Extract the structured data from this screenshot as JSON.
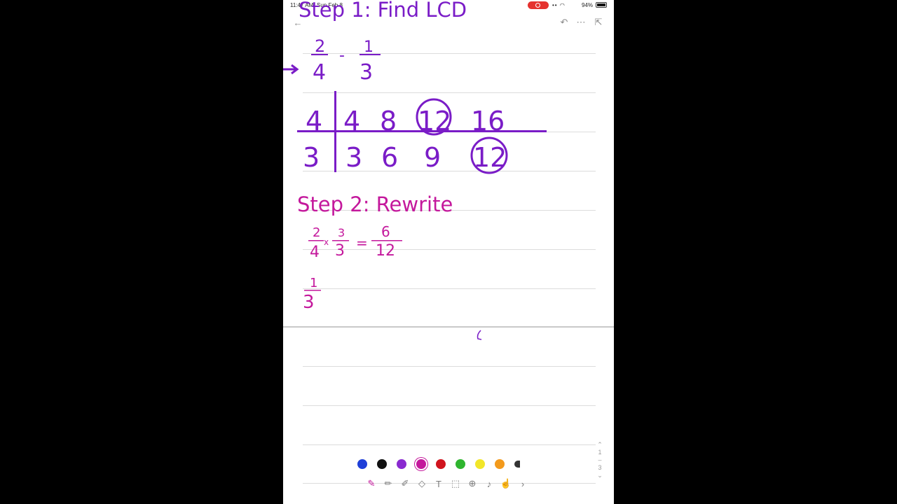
{
  "status_bar": {
    "time": "11:47 AM",
    "date": "Sun Feb 8",
    "battery": "94%"
  },
  "note": {
    "step1": {
      "heading": "Step 1: Find LCD",
      "fraction_a": {
        "numerator": "2",
        "denominator": "4"
      },
      "operator": "-",
      "fraction_b": {
        "numerator": "1",
        "denominator": "3"
      },
      "table": {
        "row_header_top": "4",
        "row_top": [
          "4",
          "8",
          "12",
          "16"
        ],
        "row_header_bottom": "3",
        "row_bottom": [
          "3",
          "6",
          "9",
          "12"
        ]
      }
    },
    "step2": {
      "heading": "Step 2: Rewrite",
      "eq_a": {
        "num": "2",
        "den": "4",
        "times": "x",
        "m_num": "3",
        "m_den": "3",
        "eq": "=",
        "r_num": "6",
        "r_den": "12"
      },
      "frac_b": {
        "num": "1",
        "den": "3"
      }
    }
  },
  "palette": {
    "ink_purple": "#7a1cc7",
    "ink_magenta": "#c4189c",
    "colors": [
      "#1f3fd8",
      "#111111",
      "#8a2ad0",
      "#c4189c",
      "#d0141e",
      "#2fb52f",
      "#f2e62a",
      "#f39a1c",
      "#333333"
    ]
  },
  "toolbar": {
    "tools": [
      "pen-icon",
      "pencil-icon",
      "highlighter-icon",
      "eraser-icon",
      "text-icon",
      "lasso-icon",
      "add-icon",
      "mic-icon",
      "touch-icon",
      "chevron-right-icon"
    ]
  },
  "page_indicator": {
    "current": "1",
    "total": "3"
  }
}
